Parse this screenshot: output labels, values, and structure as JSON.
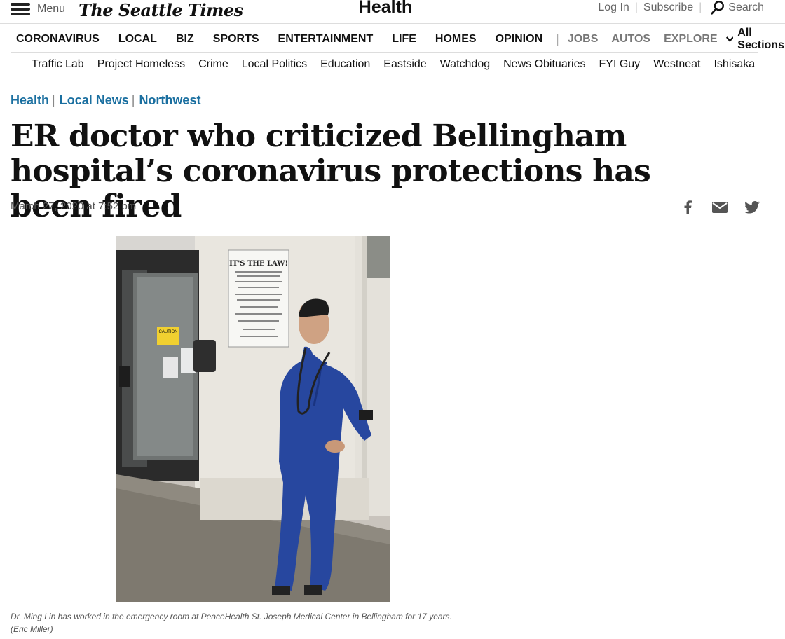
{
  "header": {
    "menu_label": "Menu",
    "logo_text": "The Seattle Times",
    "section_title": "Health",
    "login": "Log In",
    "subscribe": "Subscribe",
    "search": "Search"
  },
  "main_nav": {
    "items": [
      "CORONAVIRUS",
      "LOCAL",
      "BIZ",
      "SPORTS",
      "ENTERTAINMENT",
      "LIFE",
      "HOMES",
      "OPINION"
    ],
    "divider": "|",
    "secondary_items": [
      "JOBS",
      "AUTOS",
      "EXPLORE"
    ],
    "all_sections": "All Sections"
  },
  "sub_nav": {
    "items": [
      "Traffic Lab",
      "Project Homeless",
      "Crime",
      "Local Politics",
      "Education",
      "Eastside",
      "Watchdog",
      "News Obituaries",
      "FYI Guy",
      "Westneat",
      "Ishisaka"
    ]
  },
  "article": {
    "breadcrumbs": [
      "Health",
      "Local News",
      "Northwest"
    ],
    "headline": "ER doctor who criticized Bellingham hospital’s coronavirus protections has been fired",
    "date": "March 27, 2020 at 7:52 pm",
    "photo": {
      "sign_title": "IT'S THE LAW!",
      "caution": "CAUTION"
    },
    "caption": "Dr. Ming Lin has worked in the emergency room at PeaceHealth St. Joseph Medical Center in Bellingham for 17 years.",
    "credit": "(Eric Miller)"
  },
  "icons": {
    "share": [
      "facebook-icon",
      "email-icon",
      "twitter-icon"
    ],
    "colors": {
      "link_blue": "#1a6fa0",
      "icon_gray": "#555555"
    }
  }
}
